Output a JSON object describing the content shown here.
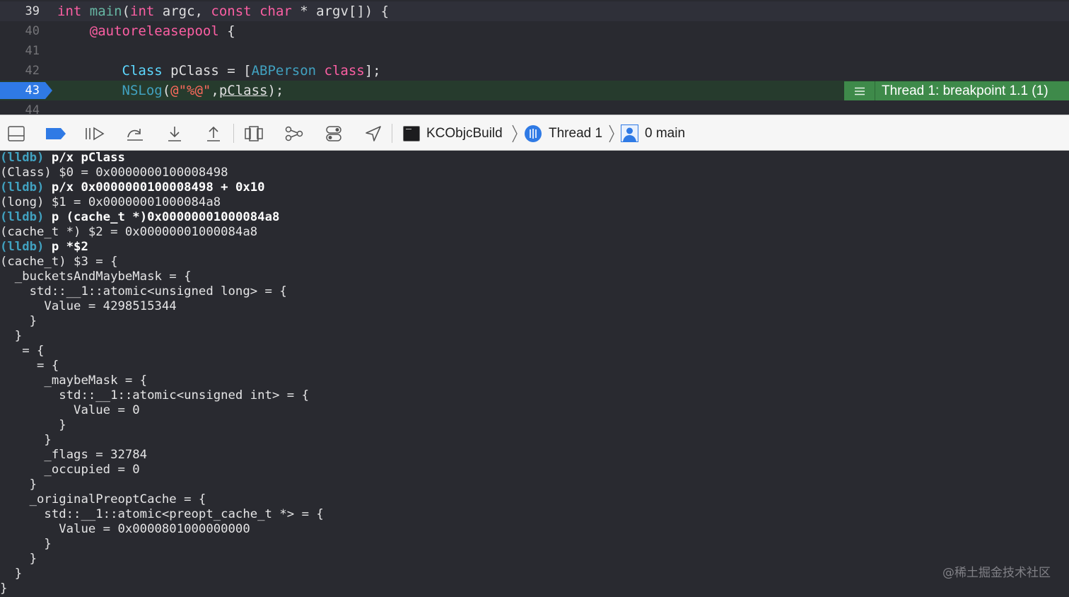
{
  "editor": {
    "lines": [
      {
        "number": "39",
        "tokens": [
          {
            "t": "int",
            "c": "kw"
          },
          {
            "t": " "
          },
          {
            "t": "main",
            "c": "fn"
          },
          {
            "t": "("
          },
          {
            "t": "int",
            "c": "kw"
          },
          {
            "t": " argc, "
          },
          {
            "t": "const",
            "c": "kw"
          },
          {
            "t": " "
          },
          {
            "t": "char",
            "c": "kw"
          },
          {
            "t": " * argv[]) {"
          }
        ]
      },
      {
        "number": "40",
        "tokens": [
          {
            "t": "    "
          },
          {
            "t": "@autoreleasepool",
            "c": "kw"
          },
          {
            "t": " {"
          }
        ]
      },
      {
        "number": "41",
        "tokens": []
      },
      {
        "number": "42",
        "tokens": [
          {
            "t": "        "
          },
          {
            "t": "Class",
            "c": "ty"
          },
          {
            "t": " pClass = ["
          },
          {
            "t": "ABPerson",
            "c": "cls"
          },
          {
            "t": " "
          },
          {
            "t": "class",
            "c": "kw"
          },
          {
            "t": "];"
          }
        ]
      },
      {
        "number": "43",
        "tokens": [
          {
            "t": "        "
          },
          {
            "t": "NSLog",
            "c": "cls"
          },
          {
            "t": "("
          },
          {
            "t": "@\"%@\"",
            "c": "str"
          },
          {
            "t": ","
          },
          {
            "t": "pClass",
            "c": "ul"
          },
          {
            "t": ");"
          }
        ]
      },
      {
        "number": "44",
        "tokens": []
      }
    ],
    "current_line": "43",
    "thread_badge": "Thread 1: breakpoint 1.1 (1)"
  },
  "toolbar": {
    "icons": [
      "hide-debug-area-icon",
      "breakpoints-toggle-icon",
      "continue-icon",
      "step-over-icon",
      "step-into-icon",
      "step-out-icon",
      "view-hierarchy-icon",
      "memory-graph-icon",
      "environment-overrides-icon",
      "simulate-location-icon"
    ],
    "breadcrumb": {
      "target": "KCObjcBuild",
      "thread": "Thread 1",
      "frame": "0 main"
    }
  },
  "console": {
    "lines": [
      {
        "prompt": "(lldb) ",
        "cmd": "p/x pClass"
      },
      {
        "text": "(Class) $0 = 0x0000000100008498"
      },
      {
        "prompt": "(lldb) ",
        "cmd": "p/x 0x0000000100008498 + 0x10"
      },
      {
        "text": "(long) $1 = 0x00000001000084a8"
      },
      {
        "prompt": "(lldb) ",
        "cmd": "p (cache_t *)0x00000001000084a8"
      },
      {
        "text": "(cache_t *) $2 = 0x00000001000084a8"
      },
      {
        "prompt": "(lldb) ",
        "cmd": "p *$2"
      },
      {
        "text": "(cache_t) $3 = {"
      },
      {
        "text": "  _bucketsAndMaybeMask = {"
      },
      {
        "text": "    std::__1::atomic<unsigned long> = {"
      },
      {
        "text": "      Value = 4298515344"
      },
      {
        "text": "    }"
      },
      {
        "text": "  }"
      },
      {
        "text": "   = {"
      },
      {
        "text": "     = {"
      },
      {
        "text": "      _maybeMask = {"
      },
      {
        "text": "        std::__1::atomic<unsigned int> = {"
      },
      {
        "text": "          Value = 0"
      },
      {
        "text": "        }"
      },
      {
        "text": "      }"
      },
      {
        "text": "      _flags = 32784"
      },
      {
        "text": "      _occupied = 0"
      },
      {
        "text": "    }"
      },
      {
        "text": "    _originalPreoptCache = {"
      },
      {
        "text": "      std::__1::atomic<preopt_cache_t *> = {"
      },
      {
        "text": "        Value = 0x0000801000000000"
      },
      {
        "text": "      }"
      },
      {
        "text": "    }"
      },
      {
        "text": "  }"
      },
      {
        "text": "}"
      }
    ]
  },
  "watermark": "@稀土掘金技术社区",
  "colors": {
    "background": "#292a30",
    "keyword": "#fc5fa3",
    "type": "#5dd8ff",
    "class": "#41a1c0",
    "string": "#fc6a5d",
    "current_line": "#263b2d",
    "breakpoint_marker": "#2f7ae5",
    "thread_badge": "#3e8a4a"
  }
}
